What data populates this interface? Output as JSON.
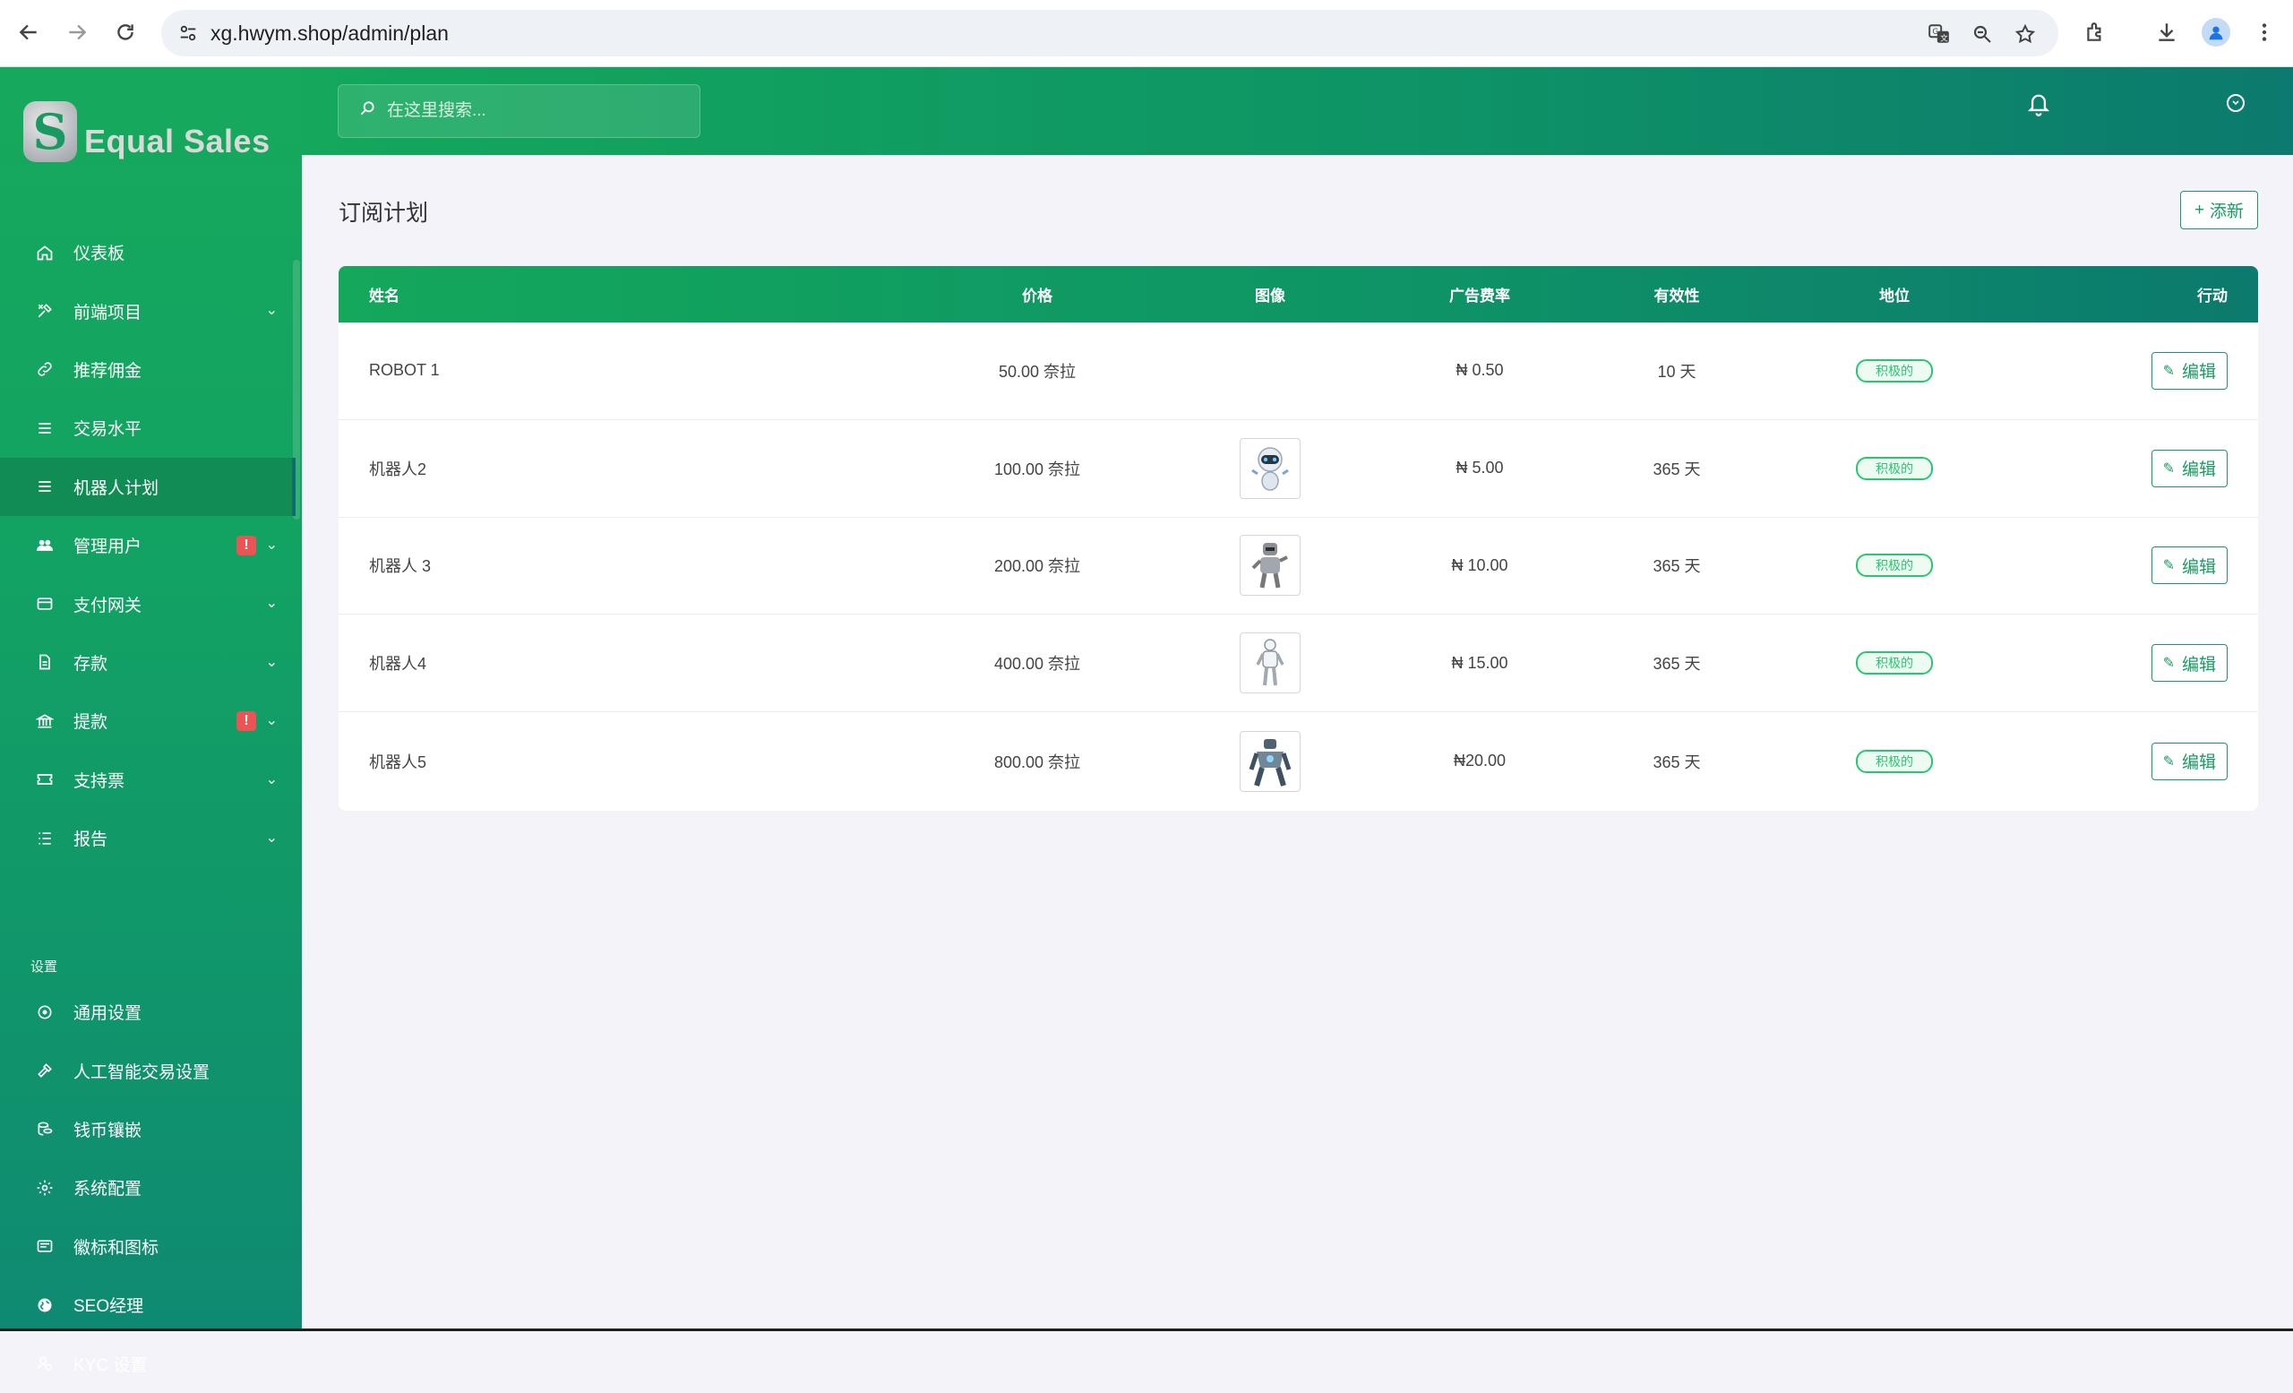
{
  "browser": {
    "url": "xg.hwym.shop/admin/plan",
    "icons": [
      "back-icon",
      "forward-icon",
      "reload-icon",
      "site-settings-icon",
      "translate-icon",
      "zoom-icon",
      "bookmark-star-icon",
      "extensions-icon",
      "download-icon",
      "profile-icon",
      "menu-kebab-icon"
    ]
  },
  "brand": {
    "logo_letter": "S",
    "name": "Equal Sales"
  },
  "header": {
    "search_placeholder": "在这里搜索..."
  },
  "sidebar": {
    "items": [
      {
        "label": "仪表板",
        "icon": "home-icon",
        "caret": false
      },
      {
        "label": "前端项目",
        "icon": "tools-icon",
        "caret": true
      },
      {
        "label": "推荐佣金",
        "icon": "link-icon",
        "caret": false
      },
      {
        "label": "交易水平",
        "icon": "list-icon",
        "caret": false
      },
      {
        "label": "机器人计划",
        "icon": "list-icon",
        "caret": false,
        "active": true
      },
      {
        "label": "管理用户",
        "icon": "users-icon",
        "caret": true,
        "badge": "!"
      },
      {
        "label": "支付网关",
        "icon": "card-icon",
        "caret": true
      },
      {
        "label": "存款",
        "icon": "file-icon",
        "caret": true
      },
      {
        "label": "提款",
        "icon": "bank-icon",
        "caret": true,
        "badge": "!"
      },
      {
        "label": "支持票",
        "icon": "ticket-icon",
        "caret": true
      },
      {
        "label": "报告",
        "icon": "report-list-icon",
        "caret": true
      }
    ],
    "section_label": "设置",
    "settings_items": [
      {
        "label": "通用设置",
        "icon": "settings-circle-icon"
      },
      {
        "label": "人工智能交易设置",
        "icon": "hammer-icon"
      },
      {
        "label": "钱币镶嵌",
        "icon": "coins-icon"
      },
      {
        "label": "系统配置",
        "icon": "gear-icon"
      },
      {
        "label": "徽标和图标",
        "icon": "image-icon"
      },
      {
        "label": "SEO经理",
        "icon": "globe-icon"
      },
      {
        "label": "KYC 设置",
        "icon": "user-check-icon"
      }
    ]
  },
  "main": {
    "title": "订阅计划",
    "add_label": "添新",
    "table": {
      "headers": {
        "name": "姓名",
        "price": "价格",
        "image": "图像",
        "rate": "广告费率",
        "validity": "有效性",
        "status": "地位",
        "action": "行动"
      },
      "rows": [
        {
          "name": "ROBOT 1",
          "price": "50.00 奈拉",
          "image": "",
          "rate": "₦ 0.50",
          "validity": "10 天",
          "status": "积极的",
          "action": "编辑"
        },
        {
          "name": "机器人2",
          "price": "100.00 奈拉",
          "image": "robot-round-icon",
          "rate": "₦ 5.00",
          "validity": "365 天",
          "status": "积极的",
          "action": "编辑"
        },
        {
          "name": "机器人 3",
          "price": "200.00 奈拉",
          "image": "robot-gray-icon",
          "rate": "₦ 10.00",
          "validity": "365 天",
          "status": "积极的",
          "action": "编辑"
        },
        {
          "name": "机器人4",
          "price": "400.00 奈拉",
          "image": "robot-white-icon",
          "rate": "₦ 15.00",
          "validity": "365 天",
          "status": "积极的",
          "action": "编辑"
        },
        {
          "name": "机器人5",
          "price": "800.00 奈拉",
          "image": "robot-mech-icon",
          "rate": "₦20.00",
          "validity": "365 天",
          "status": "积极的",
          "action": "编辑"
        }
      ]
    }
  },
  "colors": {
    "primary": "#13a85b",
    "primary_dark": "#0c7a6e",
    "success": "#28c76f",
    "danger": "#ea5455",
    "background": "#f3f3f9"
  }
}
